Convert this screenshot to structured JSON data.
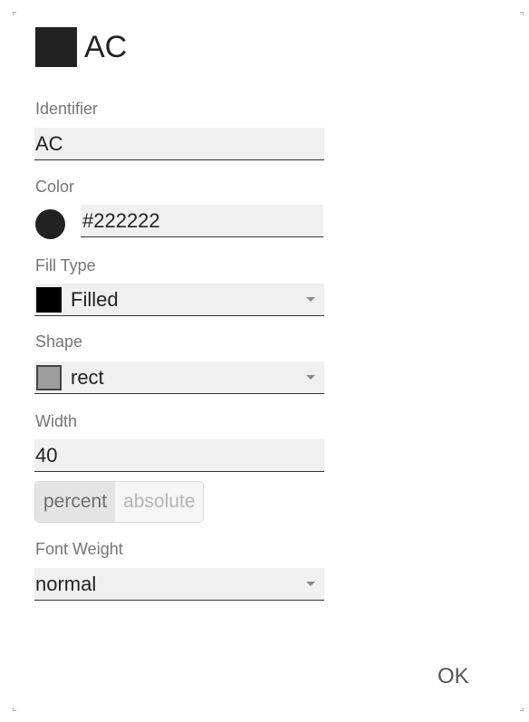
{
  "header": {
    "title": "AC",
    "swatch_color": "#222222",
    "swatch_icon": "color-swatch"
  },
  "identifier": {
    "label": "Identifier",
    "value": "AC"
  },
  "color": {
    "label": "Color",
    "value": "#222222",
    "dot_icon": "color-circle"
  },
  "fill_type": {
    "label": "Fill Type",
    "value": "Filled",
    "icon": "filled-square",
    "icon_color": "#000000"
  },
  "shape": {
    "label": "Shape",
    "value": "rect",
    "icon": "rect-shape",
    "icon_color": "#9e9e9e"
  },
  "width": {
    "label": "Width",
    "value": "40",
    "units": [
      {
        "label": "percent",
        "active": true
      },
      {
        "label": "absolute",
        "active": false
      }
    ]
  },
  "font_weight": {
    "label": "Font Weight",
    "value": "normal"
  },
  "dialog": {
    "ok_label": "OK"
  }
}
